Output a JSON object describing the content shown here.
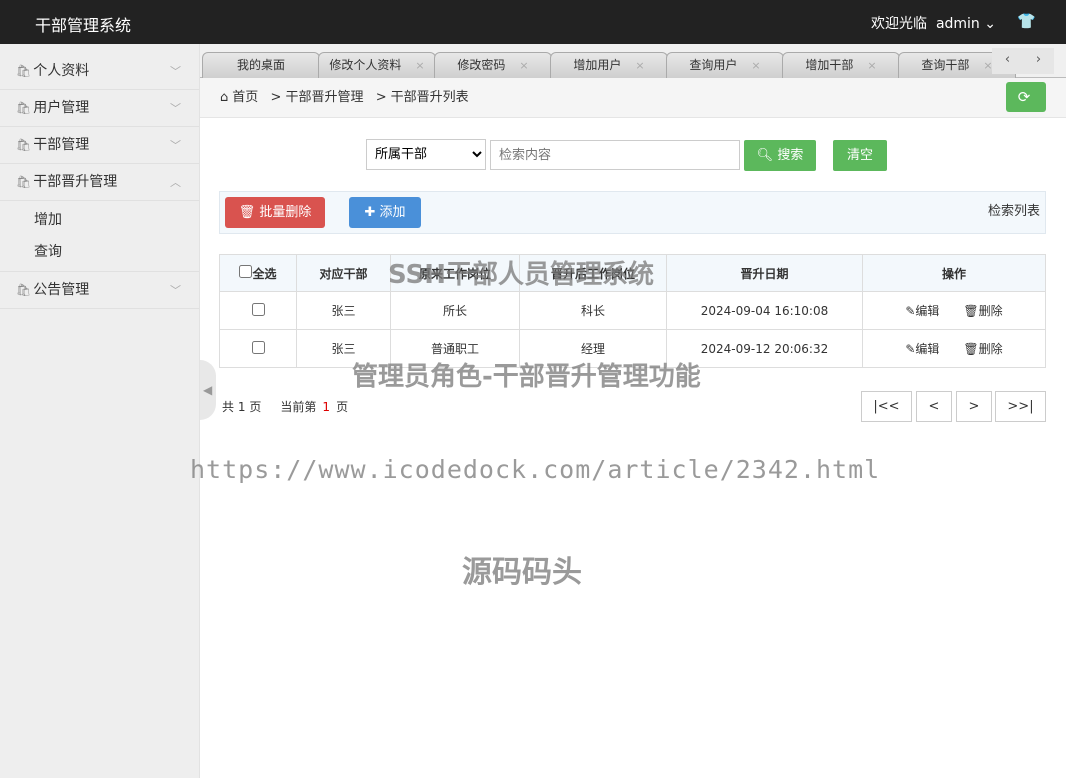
{
  "header": {
    "title": "干部管理系统",
    "welcome": "欢迎光临",
    "user": "admin"
  },
  "sidebar": {
    "items": [
      {
        "label": "个人资料"
      },
      {
        "label": "用户管理"
      },
      {
        "label": "干部管理"
      },
      {
        "label": "干部晋升管理",
        "sub": [
          "增加",
          "查询"
        ]
      },
      {
        "label": "公告管理"
      }
    ]
  },
  "tabs": [
    "我的桌面",
    "修改个人资料",
    "修改密码",
    "增加用户",
    "查询用户",
    "增加干部",
    "查询干部"
  ],
  "breadcrumb": [
    "首页",
    "干部晋升管理",
    "干部晋升列表"
  ],
  "search": {
    "select": "所属干部",
    "placeholder": "检索内容",
    "search_label": "搜索",
    "clear_label": "清空"
  },
  "toolbar": {
    "batch_delete": "批量删除",
    "add": "添加",
    "list_title": "检索列表"
  },
  "table": {
    "headers": [
      "全选",
      "对应干部",
      "原来工作岗位",
      "晋升后工作岗位",
      "晋升日期",
      "操作"
    ],
    "rows": [
      [
        "张三",
        "所长",
        "科长",
        "2024-09-04 16:10:08"
      ],
      [
        "张三",
        "普通职工",
        "经理",
        "2024-09-12 20:06:32"
      ]
    ],
    "edit": "编辑",
    "delete": "删除"
  },
  "pagination": {
    "total_prefix": "共",
    "total": "1",
    "total_suffix": "页",
    "current_prefix": "当前第",
    "current": "1",
    "current_suffix": "页",
    "first": "|<<",
    "prev": "<",
    "next": ">",
    "last": ">>|"
  },
  "watermarks": [
    "SSH干部人员管理系统",
    "管理员角色-干部晋升管理功能",
    "https://www.icodedock.com/article/2342.html",
    "源码码头"
  ],
  "colors": {
    "header": "#222222",
    "success": "#5cb85c",
    "danger": "#d9534f",
    "primary": "#4a90d9"
  }
}
